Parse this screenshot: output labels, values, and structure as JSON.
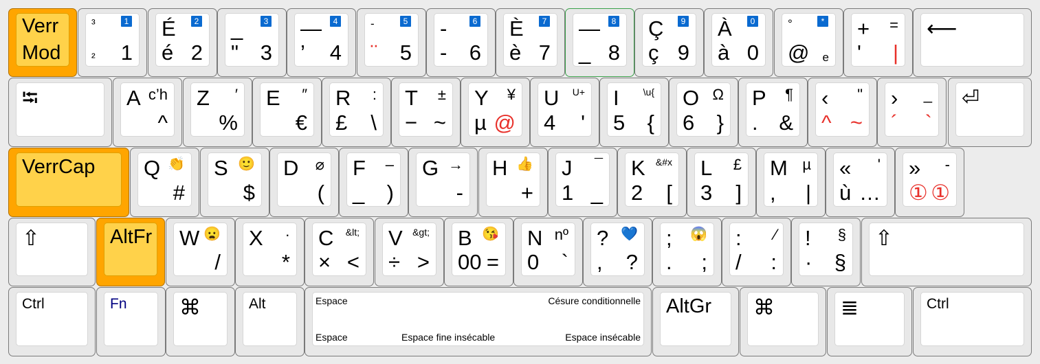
{
  "layout": "keyboard",
  "highlight_color": "#ffa500",
  "keys": [
    {
      "id": "verrmod",
      "tl": "Verr",
      "bl": "Mod",
      "cls": "hl",
      "style": "mod2"
    },
    {
      "id": "1",
      "tl": "³",
      "bl": "²",
      "br": "1",
      "num": "1",
      "tlsize": "sm",
      "blsize": "sm"
    },
    {
      "id": "2",
      "tl": "É",
      "bl": "é",
      "br": "2",
      "num": "2"
    },
    {
      "id": "3",
      "tl": "_",
      "bl": "\"",
      "br": "3",
      "num": "3"
    },
    {
      "id": "4",
      "tl": "—",
      "bl": "’",
      "br": "4",
      "num": "4"
    },
    {
      "id": "5",
      "tl": "-",
      "bl": "¨",
      "br": "5",
      "num": "5",
      "tlsize": "sm",
      "blred": true
    },
    {
      "id": "6",
      "tl": "-",
      "bl": "-",
      "br": "6",
      "num": "6"
    },
    {
      "id": "7",
      "tl": "È",
      "bl": "è",
      "br": "7",
      "num": "7"
    },
    {
      "id": "8",
      "tl": "—",
      "bl": "_",
      "br": "8",
      "num": "8",
      "cls": "green"
    },
    {
      "id": "9",
      "tl": "Ç",
      "bl": "ç",
      "br": "9",
      "num": "9"
    },
    {
      "id": "0",
      "tl": "À",
      "bl": "à",
      "br": "0",
      "num": "0"
    },
    {
      "id": "deg",
      "tl": "°",
      "bl": "@",
      "br": "e",
      "num": "*",
      "tlsize": "sm",
      "brsize": "sm"
    },
    {
      "id": "plus",
      "tl": "+",
      "tr": "=",
      "bl": "'",
      "br": "|",
      "brred": true
    },
    {
      "id": "backspace",
      "tl": "⟵"
    },
    {
      "id": "tab",
      "tl": "⭾"
    },
    {
      "id": "a",
      "tl": "A",
      "tr": "c’h",
      "br": "^"
    },
    {
      "id": "z",
      "tl": "Z",
      "tr": "′",
      "br": "%"
    },
    {
      "id": "e",
      "tl": "E",
      "tr": "″",
      "br": "€"
    },
    {
      "id": "r",
      "tl": "R",
      "tr": ":",
      "bl": "£",
      "br": "\\"
    },
    {
      "id": "t",
      "tl": "T",
      "tr": "±",
      "bl": "−",
      "br": "~"
    },
    {
      "id": "y",
      "tl": "Y",
      "tr": "¥",
      "bl": "µ",
      "br": "@",
      "brred": true
    },
    {
      "id": "u",
      "tl": "U",
      "tr": "U+",
      "bl": "4",
      "br": "'",
      "trsize": "xs"
    },
    {
      "id": "i",
      "tl": "I",
      "tr": "\\u{",
      "bl": "5",
      "br": "{",
      "trsize": "xs"
    },
    {
      "id": "o",
      "tl": "O",
      "tr": "Ω",
      "bl": "6",
      "br": "}"
    },
    {
      "id": "p",
      "tl": "P",
      "tr": "¶",
      "bl": ".",
      "br": "&"
    },
    {
      "id": "lsaquo",
      "tl": "‹",
      "tr": "\"",
      "bl": "^",
      "br": "~",
      "blred": true,
      "brred": true
    },
    {
      "id": "rsaquo",
      "tl": "›",
      "tr": "_",
      "bl": "´",
      "br": "`",
      "blred": true,
      "brred": true
    },
    {
      "id": "enter",
      "tl": "⏎"
    },
    {
      "id": "verrcap",
      "tl": "VerrCap",
      "cls": "hl"
    },
    {
      "id": "q",
      "tl": "Q",
      "tr": "👏",
      "br": "#"
    },
    {
      "id": "s",
      "tl": "S",
      "tr": "🙂",
      "br": "$"
    },
    {
      "id": "d",
      "tl": "D",
      "tr": "⌀",
      "br": "("
    },
    {
      "id": "f",
      "tl": "F",
      "tr": "–",
      "bl": "_",
      "br": ")"
    },
    {
      "id": "g",
      "tl": "G",
      "tr": "→",
      "br": "-"
    },
    {
      "id": "h",
      "tl": "H",
      "tr": "👍",
      "br": "+"
    },
    {
      "id": "j",
      "tl": "J",
      "tr": "¯",
      "bl": "1",
      "br": "_"
    },
    {
      "id": "k",
      "tl": "K",
      "tr": "&#x",
      "bl": "2",
      "br": "[",
      "trsize": "xs"
    },
    {
      "id": "l",
      "tl": "L",
      "tr": "£",
      "bl": "3",
      "br": "]"
    },
    {
      "id": "m",
      "tl": "M",
      "tr": "µ",
      "bl": ",",
      "br": "|"
    },
    {
      "id": "laquo",
      "tl": "«",
      "tr": "'",
      "bl": "ù",
      "br": "…"
    },
    {
      "id": "raquo",
      "tl": "»",
      "tr": "-",
      "bl": "①",
      "br": "①",
      "blred": true,
      "brred": true
    },
    {
      "id": "lshift",
      "tl": "⇧"
    },
    {
      "id": "altfr",
      "tl": "AltFr",
      "cls": "hl"
    },
    {
      "id": "w",
      "tl": "W",
      "tr": "😦",
      "br": "/"
    },
    {
      "id": "x",
      "tl": "X",
      "tr": "·",
      "br": "*"
    },
    {
      "id": "c",
      "tl": "C",
      "tr": "&lt;",
      "bl": "×",
      "br": "<",
      "trsize": "xs"
    },
    {
      "id": "v",
      "tl": "V",
      "tr": "&gt;",
      "bl": "÷",
      "br": ">",
      "trsize": "xs"
    },
    {
      "id": "b",
      "tl": "B",
      "tr": "😘",
      "bl": "00",
      "br": "="
    },
    {
      "id": "n",
      "tl": "N",
      "tr": "nº",
      "bl": "0",
      "br": "`"
    },
    {
      "id": "question",
      "tl": "?",
      "tr": "💙",
      "bl": ",",
      "br": "?"
    },
    {
      "id": "semicolon",
      "tl": ";",
      "tr": "😱",
      "bl": ".",
      "br": ";"
    },
    {
      "id": "colon",
      "tl": ":",
      "tr": "⁄",
      "bl": "/",
      "br": ":"
    },
    {
      "id": "exclam",
      "tl": "!",
      "tr": "§",
      "bl": "·",
      "br": "§"
    },
    {
      "id": "rshift",
      "tl": "⇧"
    },
    {
      "id": "lctrl",
      "tl": "Ctrl"
    },
    {
      "id": "fn",
      "tl": "Fn"
    },
    {
      "id": "lcmd",
      "tl": "⌘"
    },
    {
      "id": "alt",
      "tl": "Alt"
    },
    {
      "id": "space",
      "sp_tl": "Espace",
      "sp_tr": "Césure conditionnelle",
      "sp_bl": "Espace",
      "sp_bm": "Espace fine insécable",
      "sp_br": "Espace insécable"
    },
    {
      "id": "altgr",
      "tl": "AltGr"
    },
    {
      "id": "rcmd",
      "tl": "⌘"
    },
    {
      "id": "menu",
      "tl": "≣"
    },
    {
      "id": "rctrl",
      "tl": "Ctrl"
    }
  ]
}
